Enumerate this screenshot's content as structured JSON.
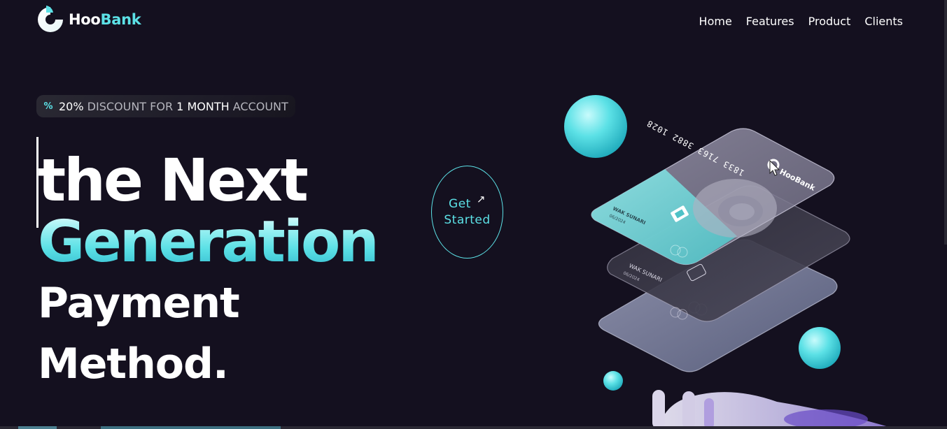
{
  "brand": {
    "name_part1": "Hoo",
    "name_part2": "Bank"
  },
  "nav": {
    "items": [
      "Home",
      "Features",
      "Product",
      "Clients"
    ]
  },
  "badge": {
    "icon": "percent-icon",
    "segments": [
      "20%",
      "DISCOUNT FOR",
      "1",
      "MONTH",
      "ACCOUNT"
    ]
  },
  "hero": {
    "line1": "the Next",
    "line2": "Generation",
    "line3": "Payment",
    "line4": "Method."
  },
  "cta": {
    "line1": "Get",
    "line2": "Started",
    "icon": "arrow-up-right-icon"
  },
  "cards": {
    "top_card_number": "1833 7163 3882 1028",
    "top_card_brand": "HooBank",
    "mid_card_holder": "WAK SUNARI",
    "mid_card_expiry": "06/2024",
    "low_card_holder": "WAK SUNARI",
    "low_card_expiry": "06/2024"
  },
  "colors": {
    "background": "#14101f",
    "accent": "#5ce1e6",
    "text": "#ffffff",
    "muted": "#b5b5bd"
  }
}
